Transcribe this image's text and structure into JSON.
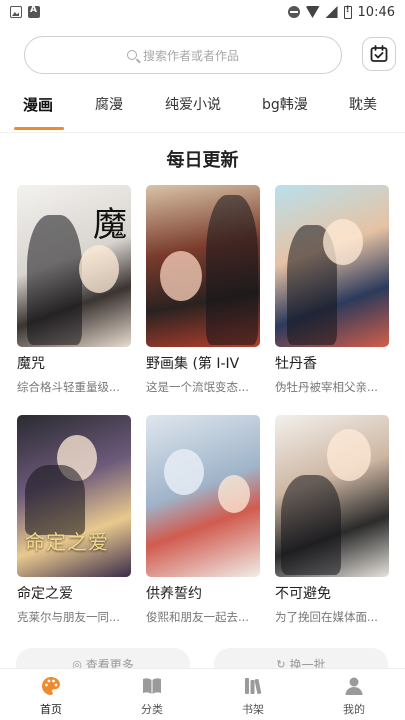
{
  "status_bar": {
    "time": "10:46"
  },
  "search": {
    "placeholder": "搜索作者或者作品"
  },
  "tabs": [
    {
      "label": "漫画",
      "active": true
    },
    {
      "label": "腐漫",
      "active": false
    },
    {
      "label": "纯爱小说",
      "active": false
    },
    {
      "label": "bg韩漫",
      "active": false
    },
    {
      "label": "耽美",
      "active": false
    }
  ],
  "section": {
    "title": "每日更新"
  },
  "comics": [
    {
      "title": "魔咒",
      "desc": "综合格斗轻重量级..."
    },
    {
      "title": "野画集 (第 I-IV",
      "desc": "这是一个流氓变态..."
    },
    {
      "title": "牡丹香",
      "desc": "伪牡丹被宰相父亲..."
    },
    {
      "title": "命定之爱",
      "desc": "克莱尔与朋友一同..."
    },
    {
      "title": "供养誓约",
      "desc": "俊熙和朋友一起去..."
    },
    {
      "title": "不可避免",
      "desc": "为了挽回在媒体面..."
    }
  ],
  "cover_art": {
    "cover_1": "魔",
    "cover_4": "命定之爱"
  },
  "more": {
    "view_more": "查看更多",
    "refresh": "换一批"
  },
  "bottom_nav": [
    {
      "label": "首页",
      "icon": "palette-icon",
      "active": true
    },
    {
      "label": "分类",
      "icon": "book-icon",
      "active": false
    },
    {
      "label": "书架",
      "icon": "bookshelf-icon",
      "active": false
    },
    {
      "label": "我的",
      "icon": "person-icon",
      "active": false
    }
  ],
  "colors": {
    "accent": "#f08a2c",
    "text": "#222222",
    "muted": "#777777"
  }
}
